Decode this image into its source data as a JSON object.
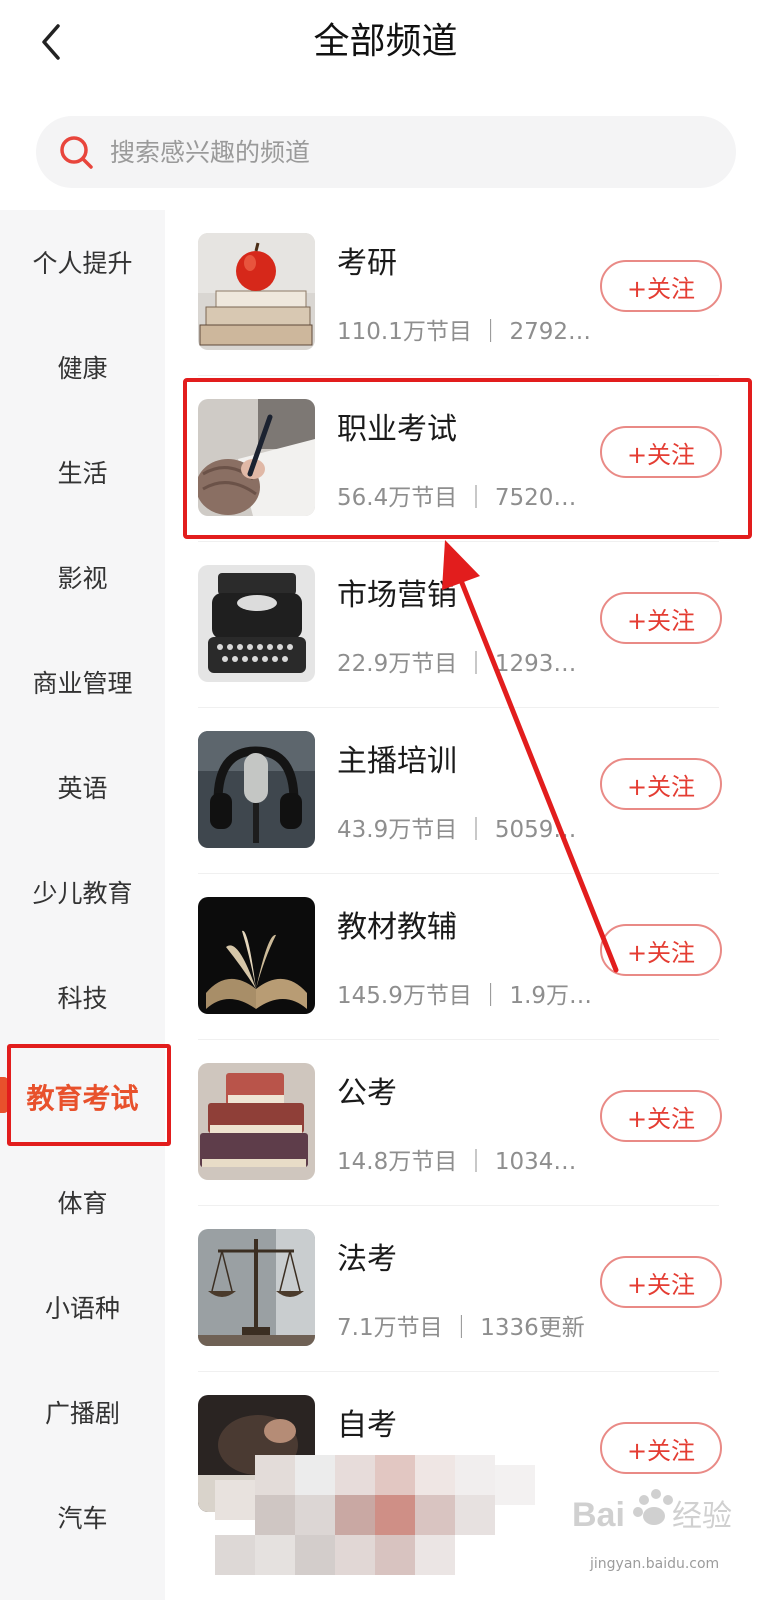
{
  "header": {
    "title": "全部频道"
  },
  "search": {
    "placeholder": "搜索感兴趣的频道"
  },
  "sidebar": {
    "items": [
      {
        "label": "个人提升"
      },
      {
        "label": "健康"
      },
      {
        "label": "生活"
      },
      {
        "label": "影视"
      },
      {
        "label": "商业管理"
      },
      {
        "label": "英语"
      },
      {
        "label": "少儿教育"
      },
      {
        "label": "科技"
      },
      {
        "label": "教育考试",
        "active": true
      },
      {
        "label": "体育"
      },
      {
        "label": "小语种"
      },
      {
        "label": "广播剧"
      },
      {
        "label": "汽车"
      }
    ]
  },
  "channels": [
    {
      "name": "考研",
      "meta": "110.1万节目 ｜ 2792…",
      "follow": "+关注",
      "thumb": "apple-on-books"
    },
    {
      "name": "职业考试",
      "meta": "56.4万节目 ｜ 7520…",
      "follow": "+关注",
      "thumb": "hand-writing-pen"
    },
    {
      "name": "市场营销",
      "meta": "22.9万节目 ｜ 1293…",
      "follow": "+关注",
      "thumb": "typewriter"
    },
    {
      "name": "主播培训",
      "meta": "43.9万节目 ｜ 5059…",
      "follow": "+关注",
      "thumb": "microphone-headphones"
    },
    {
      "name": "教材教辅",
      "meta": "145.9万节目 ｜ 1.9万…",
      "follow": "+关注",
      "thumb": "open-book"
    },
    {
      "name": "公考",
      "meta": "14.8万节目 ｜ 1034…",
      "follow": "+关注",
      "thumb": "stacked-books"
    },
    {
      "name": "法考",
      "meta": "7.1万节目 ｜ 1336更新",
      "follow": "+关注",
      "thumb": "scales-of-justice"
    },
    {
      "name": "自考",
      "meta": "",
      "follow": "+关注",
      "thumb": "hand-writing"
    }
  ],
  "colors": {
    "accent": "#e8512c",
    "annotation": "#e21d1d",
    "follow_text": "#e43d33"
  },
  "watermark": {
    "logo": "Bai du 经验",
    "url": "jingyan.baidu.com"
  }
}
